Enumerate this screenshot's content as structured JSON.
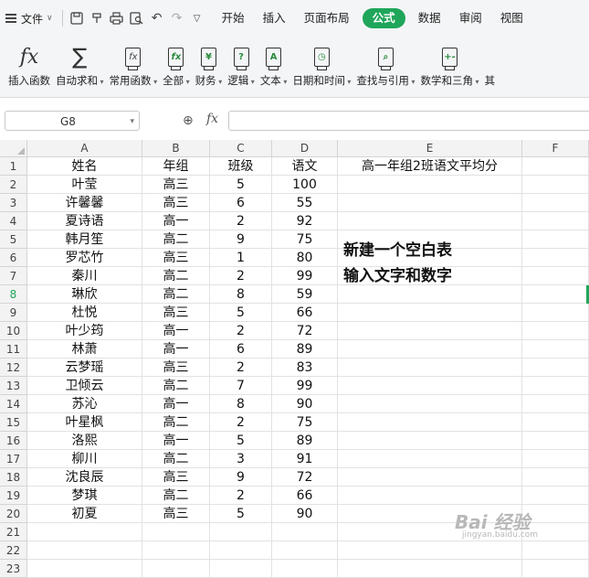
{
  "menubar": {
    "file_label": "文件",
    "tabs": [
      "开始",
      "插入",
      "页面布局",
      "公式",
      "数据",
      "审阅",
      "视图"
    ],
    "active_tab": "公式",
    "quick_icons": [
      "save-icon",
      "format-painter-icon",
      "print-icon",
      "print-preview-icon",
      "undo-icon",
      "redo-icon",
      "more-icon"
    ]
  },
  "ribbon": {
    "buttons": [
      {
        "label": "插入函数",
        "icon": "fx-icon",
        "dropdown": false
      },
      {
        "label": "自动求和",
        "icon": "sigma-icon",
        "dropdown": true
      },
      {
        "label": "常用函数",
        "icon": "star-fx-icon",
        "dropdown": true
      },
      {
        "label": "全部",
        "icon": "fx-book-icon",
        "dropdown": true
      },
      {
        "label": "财务",
        "icon": "yen-book-icon",
        "dropdown": true
      },
      {
        "label": "逻辑",
        "icon": "question-book-icon",
        "dropdown": true
      },
      {
        "label": "文本",
        "icon": "text-book-icon",
        "dropdown": true
      },
      {
        "label": "日期和时间",
        "icon": "clock-book-icon",
        "dropdown": true
      },
      {
        "label": "查找与引用",
        "icon": "search-book-icon",
        "dropdown": true
      },
      {
        "label": "数学和三角",
        "icon": "math-book-icon",
        "dropdown": true
      },
      {
        "label": "其",
        "icon": "",
        "dropdown": false
      }
    ]
  },
  "formula_bar": {
    "name_box": "G8",
    "fx_label": "fx",
    "formula": ""
  },
  "sheet": {
    "columns": [
      "A",
      "B",
      "C",
      "D",
      "E",
      "F"
    ],
    "row_numbers": [
      "1",
      "2",
      "3",
      "4",
      "5",
      "6",
      "7",
      "8",
      "9",
      "10",
      "11",
      "12",
      "13",
      "14",
      "15",
      "16",
      "17",
      "18",
      "19",
      "20",
      "21",
      "22",
      "23"
    ],
    "selected_row": "8",
    "header": [
      "姓名",
      "年组",
      "班级",
      "语文"
    ],
    "e1": "高一年组2班语文平均分",
    "rows": [
      [
        "叶莹",
        "高三",
        "5",
        "100"
      ],
      [
        "许馨馨",
        "高三",
        "6",
        "55"
      ],
      [
        "夏诗语",
        "高一",
        "2",
        "92"
      ],
      [
        "韩月笙",
        "高二",
        "9",
        "75"
      ],
      [
        "罗芯竹",
        "高三",
        "1",
        "80"
      ],
      [
        "秦川",
        "高二",
        "2",
        "99"
      ],
      [
        "琳欣",
        "高二",
        "8",
        "59"
      ],
      [
        "杜悦",
        "高三",
        "5",
        "66"
      ],
      [
        "叶少筠",
        "高一",
        "2",
        "72"
      ],
      [
        "林萧",
        "高一",
        "6",
        "89"
      ],
      [
        "云梦瑶",
        "高三",
        "2",
        "83"
      ],
      [
        "卫倾云",
        "高二",
        "7",
        "99"
      ],
      [
        "苏沁",
        "高一",
        "8",
        "90"
      ],
      [
        "叶星枫",
        "高二",
        "2",
        "75"
      ],
      [
        "洛熙",
        "高一",
        "5",
        "89"
      ],
      [
        "柳川",
        "高二",
        "3",
        "91"
      ],
      [
        "沈良辰",
        "高三",
        "9",
        "72"
      ],
      [
        "梦琪",
        "高二",
        "2",
        "66"
      ],
      [
        "初夏",
        "高三",
        "5",
        "90"
      ]
    ],
    "note_lines": [
      "新建一个空白表",
      "输入文字和数字"
    ]
  },
  "watermark": {
    "main": "Bai 经验",
    "sub": "jingyan.baidu.com"
  },
  "colors": {
    "accent": "#1fa65a"
  }
}
